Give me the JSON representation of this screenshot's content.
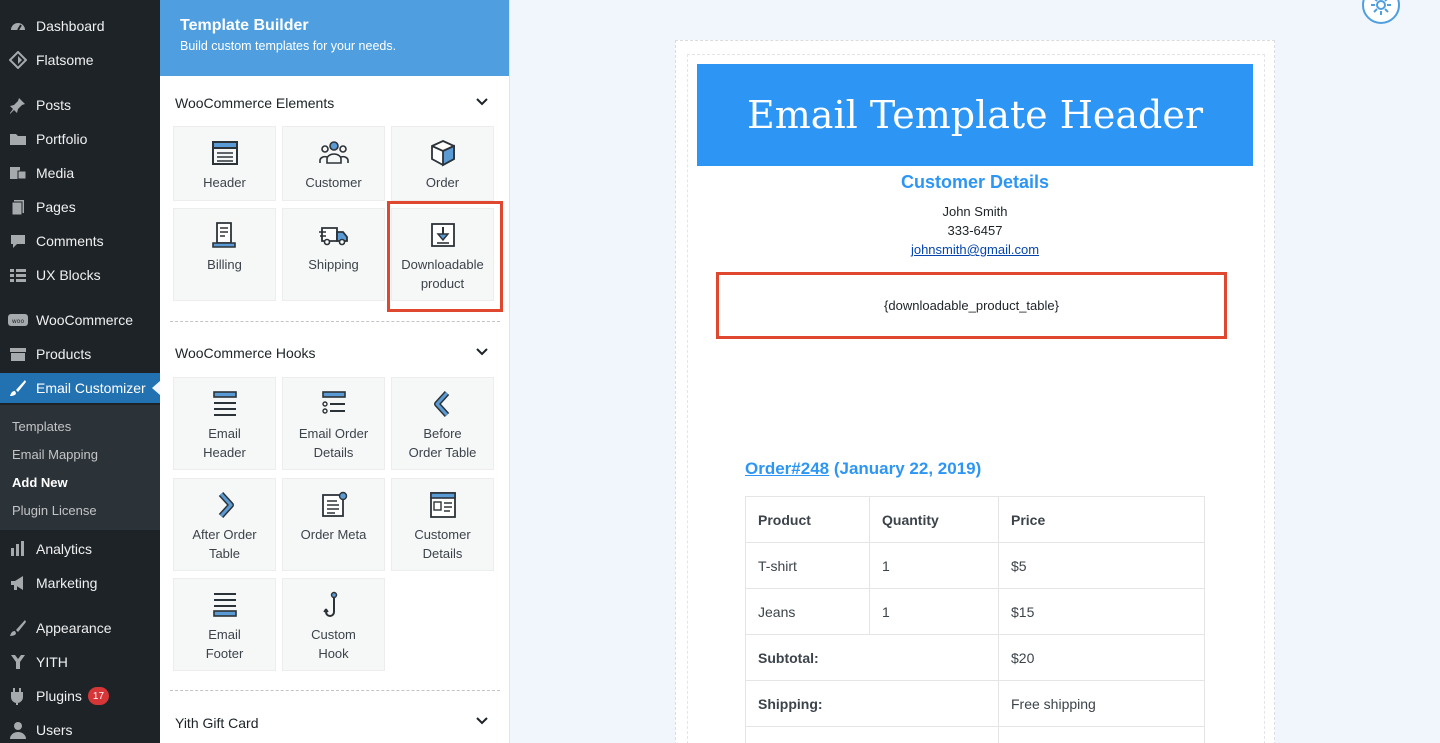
{
  "wp_menu": {
    "items": [
      {
        "label": "Dashboard",
        "icon": "dashboard-icon"
      },
      {
        "label": "Flatsome",
        "icon": "flatsome-icon"
      },
      {
        "label": "Posts",
        "icon": "pin-icon"
      },
      {
        "label": "Portfolio",
        "icon": "folder-icon"
      },
      {
        "label": "Media",
        "icon": "media-icon"
      },
      {
        "label": "Pages",
        "icon": "page-icon"
      },
      {
        "label": "Comments",
        "icon": "comment-icon"
      },
      {
        "label": "UX Blocks",
        "icon": "grid-icon"
      },
      {
        "label": "WooCommerce",
        "icon": "woo-icon"
      },
      {
        "label": "Products",
        "icon": "archive-icon"
      },
      {
        "label": "Email Customizer",
        "icon": "brush-icon"
      },
      {
        "label": "Analytics",
        "icon": "bar-chart-icon"
      },
      {
        "label": "Marketing",
        "icon": "megaphone-icon"
      },
      {
        "label": "Appearance",
        "icon": "paintbrush-icon"
      },
      {
        "label": "YITH",
        "icon": "yith-icon"
      },
      {
        "label": "Plugins",
        "icon": "plug-icon",
        "badge": "17"
      },
      {
        "label": "Users",
        "icon": "user-icon"
      }
    ],
    "submenu": [
      "Templates",
      "Email Mapping",
      "Add New",
      "Plugin License"
    ],
    "accent": "#2271b1"
  },
  "builder": {
    "title": "Template Builder",
    "subtitle": "Build custom templates for your needs.",
    "sections": {
      "woo_elements": {
        "title": "WooCommerce Elements",
        "tiles": [
          "Header",
          "Customer",
          "Order",
          "Billing",
          "Shipping",
          "Downloadable product"
        ]
      },
      "woo_hooks": {
        "title": "WooCommerce Hooks",
        "tiles": [
          "Email Header",
          "Email Order Details",
          "Before Order Table",
          "After Order Table",
          "Order Meta",
          "Customer Details",
          "Email Footer",
          "Custom Hook"
        ]
      },
      "yith": {
        "title": "Yith Gift Card"
      }
    },
    "header_color": "#4f9fe0"
  },
  "email": {
    "header_title": "Email Template Header",
    "header_color": "#2d96f5",
    "customer": {
      "title": "Customer Details",
      "name": "John Smith",
      "phone": "333-6457",
      "email": "johnsmith@gmail.com"
    },
    "placeholder": "{downloadable_product_table}",
    "order": {
      "link": "Order#248",
      "date": " (January 22, 2019)",
      "headers": [
        "Product",
        "Quantity",
        "Price"
      ],
      "rows": [
        [
          "T-shirt",
          "1",
          "$5"
        ],
        [
          "Jeans",
          "1",
          "$15"
        ]
      ],
      "totals": [
        {
          "label": "Subtotal:",
          "value": "$20"
        },
        {
          "label": "Shipping:",
          "value": "Free shipping"
        }
      ]
    }
  }
}
